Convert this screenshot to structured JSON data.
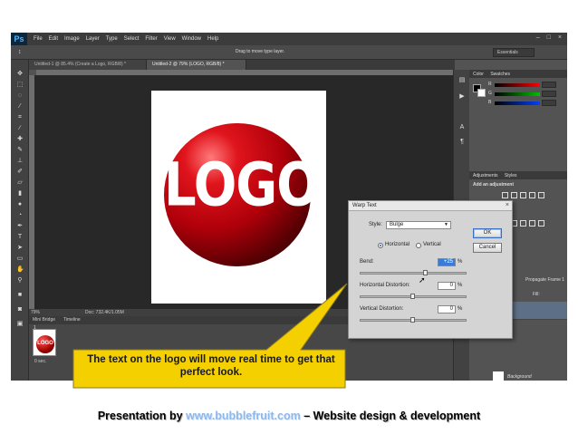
{
  "app": {
    "logo": "Ps",
    "menus": [
      "File",
      "Edit",
      "Image",
      "Layer",
      "Type",
      "Select",
      "Filter",
      "View",
      "Window",
      "Help"
    ],
    "window_controls": [
      "–",
      "□",
      "×"
    ]
  },
  "options_bar": {
    "tool_glyph": "↕",
    "hint": "Drag to move type layer.",
    "workspace": "Essentials"
  },
  "tabs": [
    {
      "label": "Untitled-1 @ 85.4% (Create a Logo, RGB/8) *",
      "active": false
    },
    {
      "label": "Untitled-2 @ 79% (LOGO, RGB/8) *",
      "active": true
    }
  ],
  "canvas": {
    "logo_text": "LOGO"
  },
  "status": {
    "zoom": "79%",
    "doc_size": "Doc: 732.4K/1.05M"
  },
  "timeline": {
    "tabs": [
      "Mini Bridge",
      "Timeline"
    ],
    "frame_number": "1",
    "frame_time": "0 sec.",
    "thumb_text": "LOGO"
  },
  "panels": {
    "color_tabs": [
      "Color",
      "Swatches"
    ],
    "rgb_labels": [
      "R",
      "G",
      "B"
    ],
    "adjustment_tabs": [
      "Adjustments",
      "Styles"
    ],
    "adjustment_title": "Add an adjustment",
    "propagate": "Propagate Frame 1",
    "fill_label": "Fill:",
    "background_layer": "Background"
  },
  "warp_dialog": {
    "title": "Warp Text",
    "style_label": "Style:",
    "style_value": "Bulge",
    "orientation": [
      "Horizontal",
      "Vertical"
    ],
    "bend_label": "Bend:",
    "bend_value": "+25",
    "h_distortion_label": "Horizontal Distortion:",
    "h_distortion_value": "0",
    "v_distortion_label": "Vertical Distortion:",
    "v_distortion_value": "0",
    "percent": "%",
    "ok": "OK",
    "cancel": "Cancel",
    "bend_level_pct": 62,
    "h_level_pct": 50,
    "v_level_pct": 50
  },
  "callout": {
    "text": "The text on the logo will move real time to get that perfect look.",
    "fill": "#f5d000"
  },
  "footer": {
    "prefix": "Presentation by ",
    "link": "www.bubblefruit.com",
    "suffix": " – Website design & development"
  },
  "colors": {
    "logo_red": "#d8101a",
    "link_blue": "#8fb8ea"
  }
}
